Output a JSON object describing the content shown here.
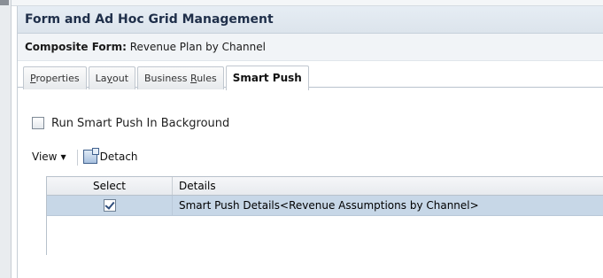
{
  "panel": {
    "title": "Form and Ad Hoc Grid Management"
  },
  "composite": {
    "label": "Composite Form:",
    "value": "Revenue Plan by Channel"
  },
  "tabs": [
    {
      "label_pre": "",
      "label_u": "P",
      "label_post": "roperties",
      "active": false
    },
    {
      "label_pre": "La",
      "label_u": "y",
      "label_post": "out",
      "active": false
    },
    {
      "label_pre": "Business ",
      "label_u": "R",
      "label_post": "ules",
      "active": false
    },
    {
      "label_pre": "Smart Push",
      "label_u": "",
      "label_post": "",
      "active": true
    }
  ],
  "options": {
    "run_in_background_label": "Run Smart Push In Background",
    "run_in_background_checked": false
  },
  "toolbar": {
    "view_label": "View",
    "detach_label": "Detach"
  },
  "grid": {
    "columns": [
      "Select",
      "Details"
    ],
    "rows": [
      {
        "selected": true,
        "details": "Smart Push Details<Revenue Assumptions by Channel>"
      }
    ]
  }
}
